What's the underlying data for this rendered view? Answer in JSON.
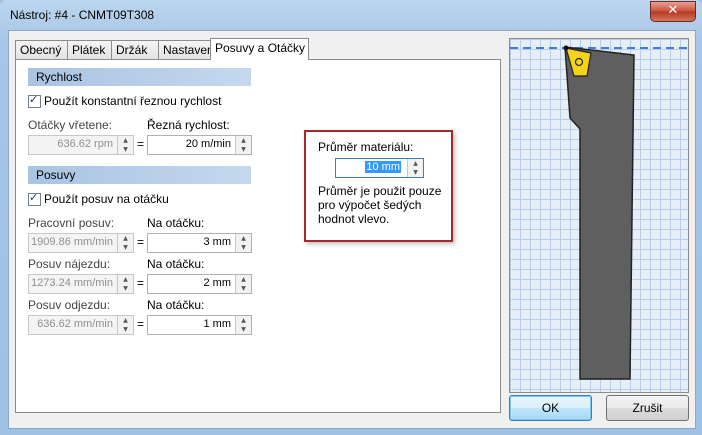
{
  "window": {
    "title": "Nástroj: #4 - CNMT09T308",
    "close_label": "✕"
  },
  "tabs": [
    {
      "label": "Obecný",
      "active": false
    },
    {
      "label": "Plátek",
      "active": false
    },
    {
      "label": "Držák",
      "active": false
    },
    {
      "label": "Nastavení",
      "active": false
    },
    {
      "label": "Posuvy a Otáčky",
      "active": true
    }
  ],
  "speed": {
    "header": "Rychlost",
    "const_speed_label": "Použít konstantní řeznou rychlost",
    "const_speed_checked": true,
    "spindle_label": "Otáčky vřetene:",
    "spindle_value": "636.62 rpm",
    "cutting_label": "Řezná rychlost:",
    "cutting_value": "20 m/min",
    "equals": "="
  },
  "feeds": {
    "header": "Posuvy",
    "per_rev_label": "Použít posuv na otáčku",
    "per_rev_checked": true,
    "rows": [
      {
        "label": "Pracovní posuv:",
        "value": "1909.86 mm/min",
        "per_label": "Na otáčku:",
        "per_value": "3 mm"
      },
      {
        "label": "Posuv nájezdu:",
        "value": "1273.24 mm/min",
        "per_label": "Na otáčku:",
        "per_value": "2 mm"
      },
      {
        "label": "Posuv odjezdu:",
        "value": "636.62 mm/min",
        "per_label": "Na otáčku:",
        "per_value": "1 mm"
      }
    ],
    "equals": "="
  },
  "diameter": {
    "label": "Průměr materiálu:",
    "value": "10 mm",
    "note_lines": [
      "Průměr je použit pouze",
      "pro výpočet šedých",
      "hodnot vlevo."
    ]
  },
  "buttons": {
    "ok": "OK",
    "cancel": "Zrušit"
  },
  "colors": {
    "accent_red": "#a22a2a",
    "tool_body": "#5f5f5f",
    "insert": "#f5d31a",
    "dashed_line": "#3c7fe0"
  }
}
